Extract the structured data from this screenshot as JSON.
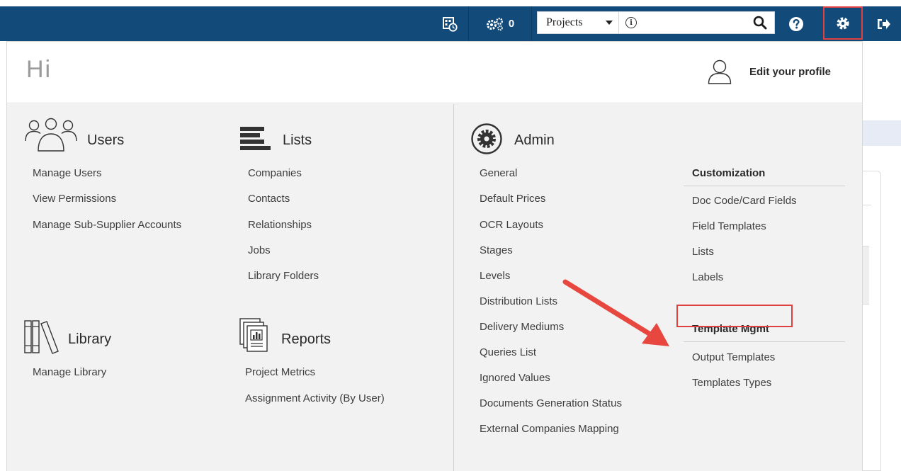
{
  "navbar": {
    "cog_count": "0",
    "search": {
      "scope": "Projects",
      "placeholder": ""
    }
  },
  "profile": {
    "greeting": "Hi",
    "edit_label": "Edit your profile"
  },
  "users": {
    "title": "Users",
    "items": [
      "Manage Users",
      "View Permissions",
      "Manage Sub-Supplier Accounts"
    ]
  },
  "lists": {
    "title": "Lists",
    "items": [
      "Companies",
      "Contacts",
      "Relationships",
      "Jobs",
      "Library Folders"
    ]
  },
  "library": {
    "title": "Library",
    "items": [
      "Manage Library"
    ]
  },
  "reports": {
    "title": "Reports",
    "items": [
      "Project Metrics",
      "Assignment Activity (By User)"
    ]
  },
  "admin": {
    "title": "Admin",
    "items": [
      "General",
      "Default Prices",
      "OCR Layouts",
      "Stages",
      "Levels",
      "Distribution Lists",
      "Delivery Mediums",
      "Queries List",
      "Ignored Values",
      "Documents Generation Status",
      "External Companies Mapping"
    ]
  },
  "customization": {
    "title": "Customization",
    "items": [
      "Doc Code/Card Fields",
      "Field Templates",
      "Lists",
      "Labels"
    ]
  },
  "template_mgmt": {
    "title": "Template Mgmt",
    "items": [
      "Output Templates",
      "Templates Types"
    ]
  },
  "colors": {
    "navbar": "#124a7a",
    "highlight": "#e04040",
    "arrow": "#e8473f"
  }
}
